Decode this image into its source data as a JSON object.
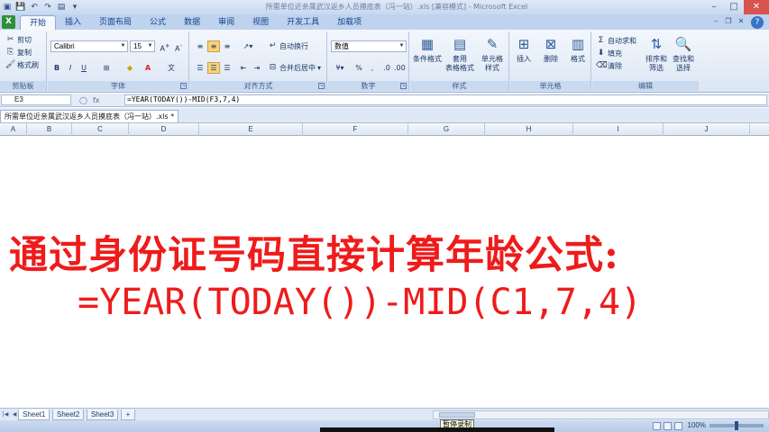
{
  "window": {
    "title": "所需单位近亲属武汉返乡人员摸底表（冯一站）.xls  [兼容模式] - Microsoft Excel"
  },
  "ribbon_tabs": [
    "开始",
    "插入",
    "页面布局",
    "公式",
    "数据",
    "审阅",
    "视图",
    "开发工具",
    "加载项"
  ],
  "clipboard": {
    "cut": "剪切",
    "copy": "复制",
    "format_painter": "格式刷",
    "label": "剪贴板"
  },
  "font": {
    "name": "Calibri",
    "size": "15",
    "label": "字体",
    "bold": "B",
    "italic": "I",
    "underline": "U"
  },
  "alignment": {
    "wrap": "自动换行",
    "merge": "合并后居中",
    "label": "对齐方式"
  },
  "number": {
    "format": "数值",
    "percent": "%",
    "comma": ",",
    "label": "数字"
  },
  "styles": {
    "conditional": "条件格式",
    "table_top": "套用",
    "table_bottom": "表格格式",
    "cell_top": "单元格",
    "cell_bottom": "样式",
    "label": "样式"
  },
  "cells": {
    "insert": "插入",
    "delete": "删除",
    "format": "格式",
    "label": "单元格"
  },
  "editing": {
    "autosum": "自动求和",
    "fill": "填充",
    "clear": "清除",
    "sort_top": "排序和",
    "sort_bottom": "筛选",
    "find_top": "查找和",
    "find_bottom": "选择",
    "label": "编辑"
  },
  "formula_bar": {
    "name_box": "E3",
    "formula": "=YEAR(TODAY())-MID(F3,7,4)"
  },
  "workbook_tab": "所需单位近亲属武汉返乡人员摸底表（冯一站）.xls *",
  "columns": [
    "A",
    "B",
    "C",
    "D",
    "E",
    "F",
    "G",
    "H",
    "I",
    "J"
  ],
  "content": {
    "headline": "通过身份证号码直接计算年龄公式:",
    "formula": "=YEAR(TODAY())-MID(C1,7,4)"
  },
  "sheet_tabs": [
    "Sheet1",
    "Sheet2",
    "Sheet3"
  ],
  "status": {
    "tooltip": "暂停录制",
    "zoom": "100%"
  },
  "colors": {
    "accent_red": "#ef1b1b",
    "ribbon_blue": "#bfd3ee",
    "office_green": "#2f8f3a"
  }
}
